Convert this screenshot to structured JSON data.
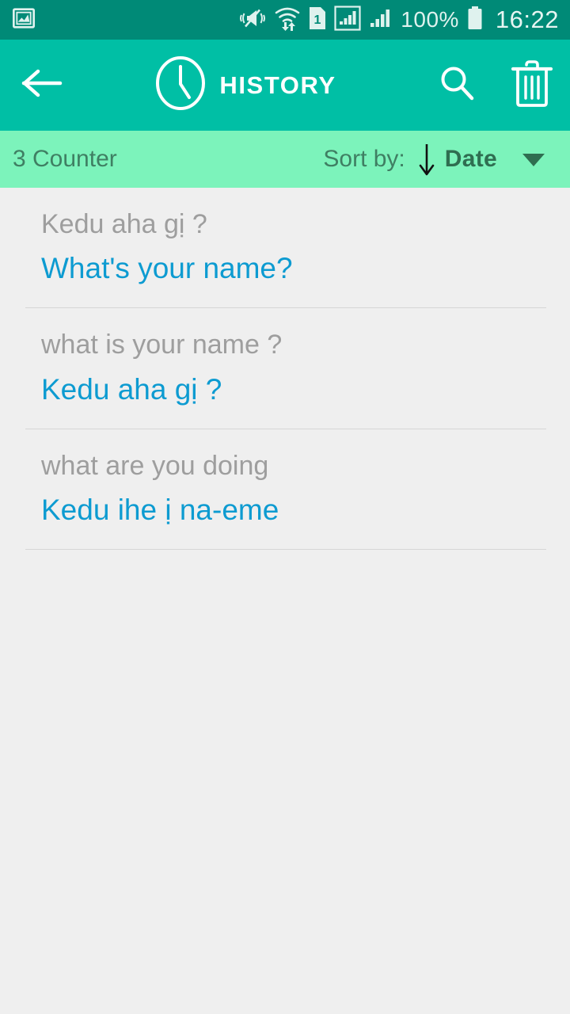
{
  "status_bar": {
    "time": "16:22",
    "battery_percent": "100%",
    "sim_label": "1",
    "icons": [
      "screenshot-image-icon",
      "vibrate-mute-icon",
      "wifi-transfer-icon",
      "sim-1-icon",
      "signal-sim1-icon",
      "signal-sim2-icon",
      "battery-full-icon"
    ],
    "background_color": "#008a77",
    "text_color": "#dff2ee"
  },
  "app_bar": {
    "back_label": "Back",
    "title": "HISTORY",
    "clock_icon": "clock-icon",
    "search_label": "Search",
    "delete_label": "Delete all",
    "background_color": "#00bfa5",
    "title_color": "#ffffff"
  },
  "sort_bar": {
    "counter_text": "3 Counter",
    "sort_by_label": "Sort by:",
    "sort_direction": "descending",
    "sort_value": "Date",
    "dropdown_icon": "chevron-down-icon",
    "background_color": "#7cf3bb",
    "label_color": "#3f7f63",
    "value_color": "#2f6e51"
  },
  "history": {
    "source_color": "#9e9e9e",
    "translation_color": "#0d9bd1",
    "items": [
      {
        "source": "Kedu aha gị ?",
        "translation": "What's your name?"
      },
      {
        "source": "what is your name ?",
        "translation": "Kedu aha gị ?"
      },
      {
        "source": "what are you doing",
        "translation": "Kedu ihe ị na-eme"
      }
    ]
  },
  "content_background": "#efefef"
}
